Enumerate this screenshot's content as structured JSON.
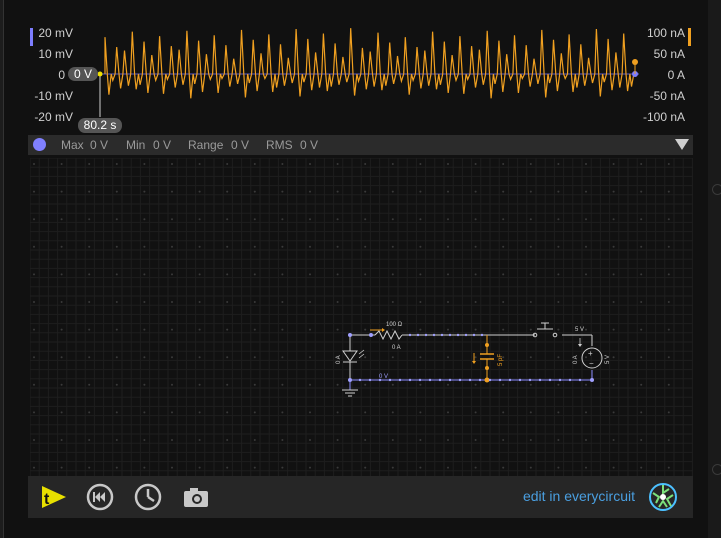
{
  "scope": {
    "left_axis": [
      "20 mV",
      "10 mV",
      "0",
      "-10 mV",
      "-20 mV"
    ],
    "right_axis": [
      "100 nA",
      "50 nA",
      "0 A",
      "-50 nA",
      "-100 nA"
    ],
    "cursor_value": "0 V",
    "cursor_time": "80.2 s",
    "colors": {
      "trace": "#f0a020",
      "left_marker": "#7d7dff",
      "right_marker": "#f0a020"
    }
  },
  "measurements": {
    "max_label": "Max",
    "max_value": "0 V",
    "min_label": "Min",
    "min_value": "0 V",
    "range_label": "Range",
    "range_value": "0 V",
    "rms_label": "RMS",
    "rms_value": "0 V"
  },
  "circuit": {
    "resistor_value": "100 Ω",
    "resistor_current": "0 A",
    "led_current": "0 A",
    "capacitor_value": "5 pF",
    "source_label_top": "5 V",
    "source_current": "0 A",
    "source_value": "5 V",
    "ground_wire_label": "0 V"
  },
  "toolbar": {
    "edit_link": "edit in everycircuit",
    "icons": [
      "logo-icon",
      "rewind-icon",
      "clock-icon",
      "camera-icon",
      "everycircuit-logo-icon"
    ]
  }
}
